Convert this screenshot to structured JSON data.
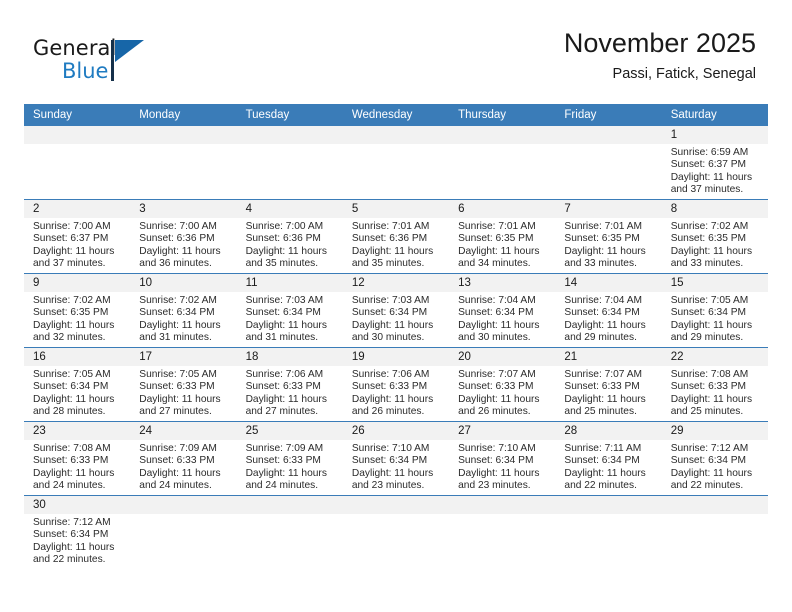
{
  "brand": {
    "name_top": "General",
    "name_bottom": "Blue",
    "accent_color": "#1f7bc1"
  },
  "header": {
    "title": "November 2025",
    "subtitle": "Passi, Fatick, Senegal"
  },
  "calendar": {
    "header_bg": "#3a7cb8",
    "weekday_headers": [
      "Sunday",
      "Monday",
      "Tuesday",
      "Wednesday",
      "Thursday",
      "Friday",
      "Saturday"
    ],
    "weeks": [
      [
        {
          "empty": true
        },
        {
          "empty": true
        },
        {
          "empty": true
        },
        {
          "empty": true
        },
        {
          "empty": true
        },
        {
          "empty": true
        },
        {
          "day": "1",
          "sunrise": "Sunrise: 6:59 AM",
          "sunset": "Sunset: 6:37 PM",
          "daylight_line1": "Daylight: 11 hours",
          "daylight_line2": "and 37 minutes."
        }
      ],
      [
        {
          "day": "2",
          "sunrise": "Sunrise: 7:00 AM",
          "sunset": "Sunset: 6:37 PM",
          "daylight_line1": "Daylight: 11 hours",
          "daylight_line2": "and 37 minutes."
        },
        {
          "day": "3",
          "sunrise": "Sunrise: 7:00 AM",
          "sunset": "Sunset: 6:36 PM",
          "daylight_line1": "Daylight: 11 hours",
          "daylight_line2": "and 36 minutes."
        },
        {
          "day": "4",
          "sunrise": "Sunrise: 7:00 AM",
          "sunset": "Sunset: 6:36 PM",
          "daylight_line1": "Daylight: 11 hours",
          "daylight_line2": "and 35 minutes."
        },
        {
          "day": "5",
          "sunrise": "Sunrise: 7:01 AM",
          "sunset": "Sunset: 6:36 PM",
          "daylight_line1": "Daylight: 11 hours",
          "daylight_line2": "and 35 minutes."
        },
        {
          "day": "6",
          "sunrise": "Sunrise: 7:01 AM",
          "sunset": "Sunset: 6:35 PM",
          "daylight_line1": "Daylight: 11 hours",
          "daylight_line2": "and 34 minutes."
        },
        {
          "day": "7",
          "sunrise": "Sunrise: 7:01 AM",
          "sunset": "Sunset: 6:35 PM",
          "daylight_line1": "Daylight: 11 hours",
          "daylight_line2": "and 33 minutes."
        },
        {
          "day": "8",
          "sunrise": "Sunrise: 7:02 AM",
          "sunset": "Sunset: 6:35 PM",
          "daylight_line1": "Daylight: 11 hours",
          "daylight_line2": "and 33 minutes."
        }
      ],
      [
        {
          "day": "9",
          "sunrise": "Sunrise: 7:02 AM",
          "sunset": "Sunset: 6:35 PM",
          "daylight_line1": "Daylight: 11 hours",
          "daylight_line2": "and 32 minutes."
        },
        {
          "day": "10",
          "sunrise": "Sunrise: 7:02 AM",
          "sunset": "Sunset: 6:34 PM",
          "daylight_line1": "Daylight: 11 hours",
          "daylight_line2": "and 31 minutes."
        },
        {
          "day": "11",
          "sunrise": "Sunrise: 7:03 AM",
          "sunset": "Sunset: 6:34 PM",
          "daylight_line1": "Daylight: 11 hours",
          "daylight_line2": "and 31 minutes."
        },
        {
          "day": "12",
          "sunrise": "Sunrise: 7:03 AM",
          "sunset": "Sunset: 6:34 PM",
          "daylight_line1": "Daylight: 11 hours",
          "daylight_line2": "and 30 minutes."
        },
        {
          "day": "13",
          "sunrise": "Sunrise: 7:04 AM",
          "sunset": "Sunset: 6:34 PM",
          "daylight_line1": "Daylight: 11 hours",
          "daylight_line2": "and 30 minutes."
        },
        {
          "day": "14",
          "sunrise": "Sunrise: 7:04 AM",
          "sunset": "Sunset: 6:34 PM",
          "daylight_line1": "Daylight: 11 hours",
          "daylight_line2": "and 29 minutes."
        },
        {
          "day": "15",
          "sunrise": "Sunrise: 7:05 AM",
          "sunset": "Sunset: 6:34 PM",
          "daylight_line1": "Daylight: 11 hours",
          "daylight_line2": "and 29 minutes."
        }
      ],
      [
        {
          "day": "16",
          "sunrise": "Sunrise: 7:05 AM",
          "sunset": "Sunset: 6:34 PM",
          "daylight_line1": "Daylight: 11 hours",
          "daylight_line2": "and 28 minutes."
        },
        {
          "day": "17",
          "sunrise": "Sunrise: 7:05 AM",
          "sunset": "Sunset: 6:33 PM",
          "daylight_line1": "Daylight: 11 hours",
          "daylight_line2": "and 27 minutes."
        },
        {
          "day": "18",
          "sunrise": "Sunrise: 7:06 AM",
          "sunset": "Sunset: 6:33 PM",
          "daylight_line1": "Daylight: 11 hours",
          "daylight_line2": "and 27 minutes."
        },
        {
          "day": "19",
          "sunrise": "Sunrise: 7:06 AM",
          "sunset": "Sunset: 6:33 PM",
          "daylight_line1": "Daylight: 11 hours",
          "daylight_line2": "and 26 minutes."
        },
        {
          "day": "20",
          "sunrise": "Sunrise: 7:07 AM",
          "sunset": "Sunset: 6:33 PM",
          "daylight_line1": "Daylight: 11 hours",
          "daylight_line2": "and 26 minutes."
        },
        {
          "day": "21",
          "sunrise": "Sunrise: 7:07 AM",
          "sunset": "Sunset: 6:33 PM",
          "daylight_line1": "Daylight: 11 hours",
          "daylight_line2": "and 25 minutes."
        },
        {
          "day": "22",
          "sunrise": "Sunrise: 7:08 AM",
          "sunset": "Sunset: 6:33 PM",
          "daylight_line1": "Daylight: 11 hours",
          "daylight_line2": "and 25 minutes."
        }
      ],
      [
        {
          "day": "23",
          "sunrise": "Sunrise: 7:08 AM",
          "sunset": "Sunset: 6:33 PM",
          "daylight_line1": "Daylight: 11 hours",
          "daylight_line2": "and 24 minutes."
        },
        {
          "day": "24",
          "sunrise": "Sunrise: 7:09 AM",
          "sunset": "Sunset: 6:33 PM",
          "daylight_line1": "Daylight: 11 hours",
          "daylight_line2": "and 24 minutes."
        },
        {
          "day": "25",
          "sunrise": "Sunrise: 7:09 AM",
          "sunset": "Sunset: 6:33 PM",
          "daylight_line1": "Daylight: 11 hours",
          "daylight_line2": "and 24 minutes."
        },
        {
          "day": "26",
          "sunrise": "Sunrise: 7:10 AM",
          "sunset": "Sunset: 6:34 PM",
          "daylight_line1": "Daylight: 11 hours",
          "daylight_line2": "and 23 minutes."
        },
        {
          "day": "27",
          "sunrise": "Sunrise: 7:10 AM",
          "sunset": "Sunset: 6:34 PM",
          "daylight_line1": "Daylight: 11 hours",
          "daylight_line2": "and 23 minutes."
        },
        {
          "day": "28",
          "sunrise": "Sunrise: 7:11 AM",
          "sunset": "Sunset: 6:34 PM",
          "daylight_line1": "Daylight: 11 hours",
          "daylight_line2": "and 22 minutes."
        },
        {
          "day": "29",
          "sunrise": "Sunrise: 7:12 AM",
          "sunset": "Sunset: 6:34 PM",
          "daylight_line1": "Daylight: 11 hours",
          "daylight_line2": "and 22 minutes."
        }
      ],
      [
        {
          "day": "30",
          "sunrise": "Sunrise: 7:12 AM",
          "sunset": "Sunset: 6:34 PM",
          "daylight_line1": "Daylight: 11 hours",
          "daylight_line2": "and 22 minutes."
        },
        {
          "empty": true
        },
        {
          "empty": true
        },
        {
          "empty": true
        },
        {
          "empty": true
        },
        {
          "empty": true
        },
        {
          "empty": true
        }
      ]
    ]
  }
}
